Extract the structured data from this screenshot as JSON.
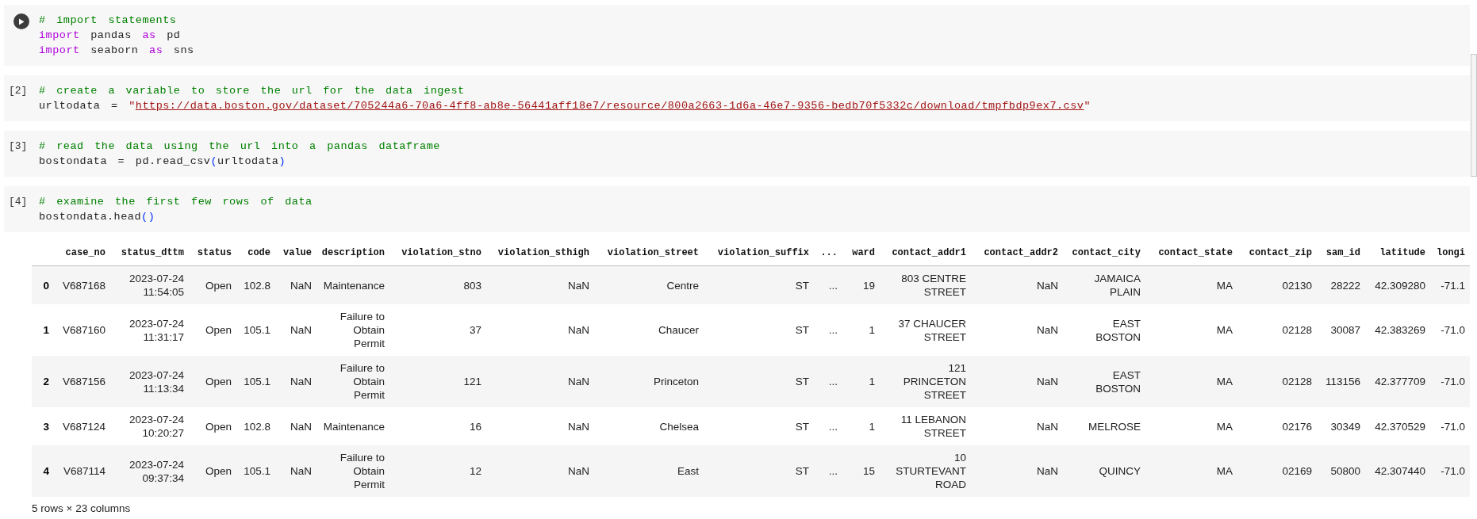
{
  "cells": [
    {
      "kind": "run_button",
      "lines": [
        [
          {
            "kind": "comment",
            "text": "# import statements"
          }
        ],
        [
          {
            "kind": "keyword",
            "text": "import"
          },
          {
            "kind": "text",
            "text": " pandas "
          },
          {
            "kind": "keyword",
            "text": "as"
          },
          {
            "kind": "text",
            "text": " pd"
          }
        ],
        [
          {
            "kind": "keyword",
            "text": "import"
          },
          {
            "kind": "text",
            "text": " seaborn "
          },
          {
            "kind": "keyword",
            "text": "as"
          },
          {
            "kind": "text",
            "text": " sns"
          }
        ]
      ]
    },
    {
      "kind": "prompt",
      "prompt": "[2]",
      "lines": [
        [
          {
            "kind": "comment",
            "text": "# create a variable to store the url for the data ingest"
          }
        ],
        [
          {
            "kind": "text",
            "text": "urltodata = "
          },
          {
            "kind": "string",
            "text": "\""
          },
          {
            "kind": "link",
            "text": "https://data.boston.gov/dataset/705244a6-70a6-4ff8-ab8e-56441aff18e7/resource/800a2663-1d6a-46e7-9356-bedb70f5332c/download/tmpfbdp9ex7.csv"
          },
          {
            "kind": "string",
            "text": "\""
          }
        ]
      ]
    },
    {
      "kind": "prompt",
      "prompt": "[3]",
      "lines": [
        [
          {
            "kind": "comment",
            "text": "# read the data using the url into a pandas dataframe"
          }
        ],
        [
          {
            "kind": "text",
            "text": "bostondata = pd.read_csv"
          },
          {
            "kind": "bracket",
            "text": "("
          },
          {
            "kind": "text",
            "text": "urltodata"
          },
          {
            "kind": "bracket",
            "text": ")"
          }
        ]
      ]
    },
    {
      "kind": "prompt",
      "prompt": "[4]",
      "lines": [
        [
          {
            "kind": "comment",
            "text": "# examine the first few rows of data"
          }
        ],
        [
          {
            "kind": "text",
            "text": "bostondata.head"
          },
          {
            "kind": "bracket",
            "text": "()"
          }
        ]
      ]
    }
  ],
  "table": {
    "columns": [
      "case_no",
      "status_dttm",
      "status",
      "code",
      "value",
      "description",
      "violation_stno",
      "violation_sthigh",
      "violation_street",
      "violation_suffix",
      "...",
      "ward",
      "contact_addr1",
      "contact_addr2",
      "contact_city",
      "contact_state",
      "contact_zip",
      "sam_id",
      "latitude",
      "longi"
    ],
    "rows": [
      {
        "index": "0",
        "cells": [
          "V687168",
          "2023-07-24 11:54:05",
          "Open",
          "102.8",
          "NaN",
          "Maintenance",
          "803",
          "NaN",
          "Centre",
          "ST",
          "...",
          "19",
          "803 CENTRE STREET",
          "NaN",
          "JAMAICA PLAIN",
          "MA",
          "02130",
          "28222",
          "42.309280",
          "-71.1"
        ]
      },
      {
        "index": "1",
        "cells": [
          "V687160",
          "2023-07-24 11:31:17",
          "Open",
          "105.1",
          "NaN",
          "Failure to Obtain Permit",
          "37",
          "NaN",
          "Chaucer",
          "ST",
          "...",
          "1",
          "37 CHAUCER STREET",
          "NaN",
          "EAST BOSTON",
          "MA",
          "02128",
          "30087",
          "42.383269",
          "-71.0"
        ]
      },
      {
        "index": "2",
        "cells": [
          "V687156",
          "2023-07-24 11:13:34",
          "Open",
          "105.1",
          "NaN",
          "Failure to Obtain Permit",
          "121",
          "NaN",
          "Princeton",
          "ST",
          "...",
          "1",
          "121 PRINCETON STREET",
          "NaN",
          "EAST BOSTON",
          "MA",
          "02128",
          "113156",
          "42.377709",
          "-71.0"
        ]
      },
      {
        "index": "3",
        "cells": [
          "V687124",
          "2023-07-24 10:20:27",
          "Open",
          "102.8",
          "NaN",
          "Maintenance",
          "16",
          "NaN",
          "Chelsea",
          "ST",
          "...",
          "1",
          "11 LEBANON STREET",
          "NaN",
          "MELROSE",
          "MA",
          "02176",
          "30349",
          "42.370529",
          "-71.0"
        ]
      },
      {
        "index": "4",
        "cells": [
          "V687114",
          "2023-07-24 09:37:34",
          "Open",
          "105.1",
          "NaN",
          "Failure to Obtain Permit",
          "12",
          "NaN",
          "East",
          "ST",
          "...",
          "15",
          "10 STURTEVANT ROAD",
          "NaN",
          "QUINCY",
          "MA",
          "02169",
          "50800",
          "42.307440",
          "-71.0"
        ]
      }
    ],
    "footer": "5 rows × 23 columns"
  }
}
